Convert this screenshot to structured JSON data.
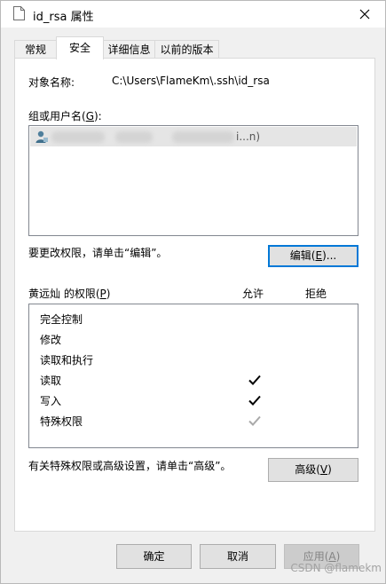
{
  "window": {
    "title": "id_rsa 属性"
  },
  "tabs": [
    {
      "label": "常规"
    },
    {
      "label": "安全"
    },
    {
      "label": "详细信息"
    },
    {
      "label": "以前的版本"
    }
  ],
  "security": {
    "object_name_label": "对象名称:",
    "object_name_value": "C:\\Users\\FlameKm\\.ssh\\id_rsa",
    "groups_label_pre": "组或用户名(",
    "groups_label_key": "G",
    "groups_label_post": "):",
    "group_item_suffix": "i...n)",
    "change_hint": "要更改权限，请单击“编辑”。",
    "edit_button_pre": "编辑(",
    "edit_button_key": "E",
    "edit_button_post": ")...",
    "perm_header_pre": "黄远灿 的权限(",
    "perm_header_key": "P",
    "perm_header_post": ")",
    "allow_col": "允许",
    "deny_col": "拒绝",
    "permissions": [
      {
        "name": "完全控制",
        "allow": false,
        "allow_state": "none"
      },
      {
        "name": "修改",
        "allow": false,
        "allow_state": "none"
      },
      {
        "name": "读取和执行",
        "allow": false,
        "allow_state": "none"
      },
      {
        "name": "读取",
        "allow": true,
        "allow_state": "checked"
      },
      {
        "name": "写入",
        "allow": true,
        "allow_state": "checked"
      },
      {
        "name": "特殊权限",
        "allow": true,
        "allow_state": "inherited-grey"
      }
    ],
    "advanced_hint": "有关特殊权限或高级设置，请单击“高级”。",
    "advanced_button_pre": "高级(",
    "advanced_button_key": "V",
    "advanced_button_post": ")"
  },
  "footer": {
    "ok_label": "确定",
    "cancel_label": "取消",
    "apply_pre": "应用(",
    "apply_key": "A",
    "apply_post": ")"
  },
  "watermark": "CSDN @flamekm",
  "colors": {
    "focus_border": "#0078d7",
    "check_dark": "#000000",
    "check_grey": "#a9a9a9"
  }
}
